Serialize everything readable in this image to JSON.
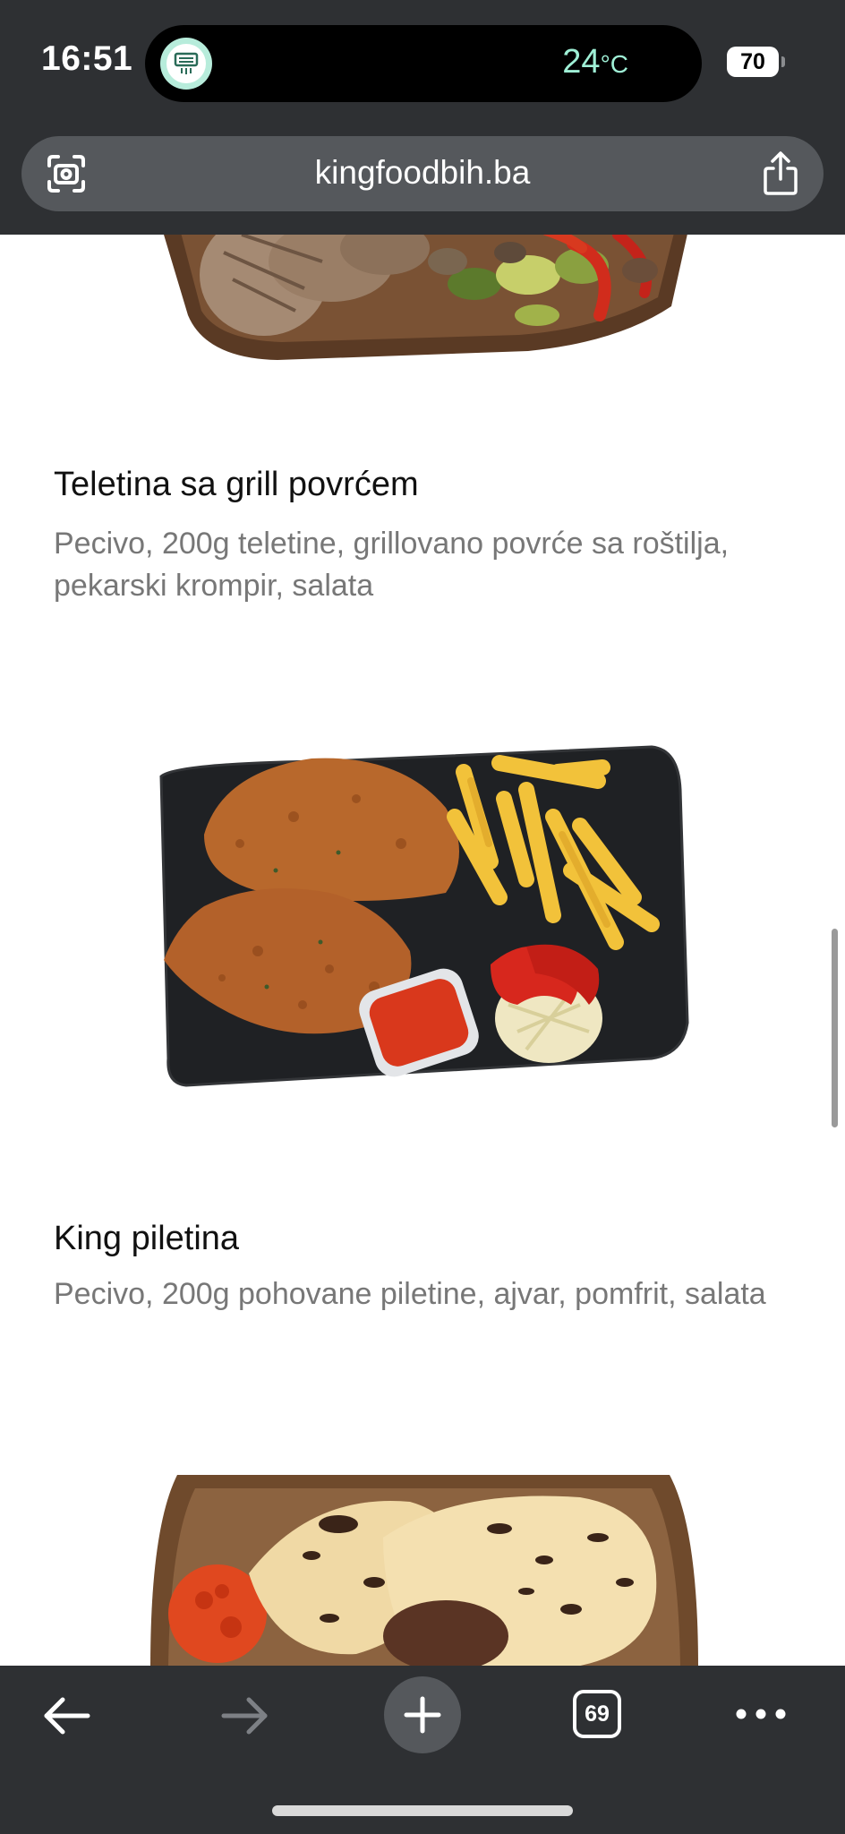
{
  "status_bar": {
    "time": "16:51",
    "temperature": "24",
    "temperature_unit": "°C",
    "battery": "70"
  },
  "browser": {
    "url": "kingfoodbih.ba",
    "tab_count": "69"
  },
  "menu_items": [
    {
      "title": "Teletina sa grill povrćem",
      "description": "Pecivo, 200g teletine, grillovano povrće sa roštilja, pekarski krompir, salata"
    },
    {
      "title": "King piletina",
      "description": "Pecivo, 200g pohovane piletine, ajvar, pomfrit, salata"
    }
  ],
  "icons": {
    "scan": "camera-scan-icon",
    "share": "share-icon",
    "back": "arrow-left-icon",
    "forward": "arrow-right-icon",
    "new_tab": "plus-icon",
    "tabs": "tabs-icon",
    "more": "more-dots-icon"
  },
  "colors": {
    "chrome_bg": "#2e3033",
    "url_bar_bg": "#55585c",
    "temp_accent": "#9ff0d6",
    "title_text": "#111111",
    "desc_text": "#777777"
  }
}
